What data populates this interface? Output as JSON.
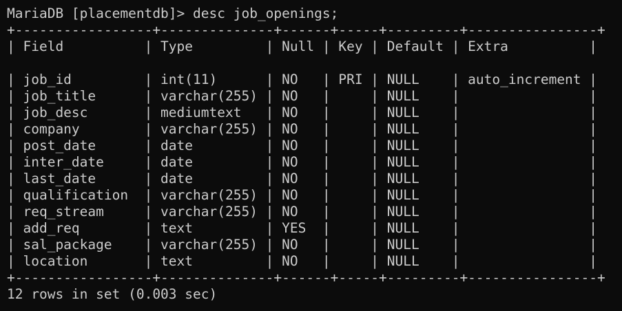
{
  "terminal": {
    "prompt": "MariaDB [placementdb]>",
    "command": " desc job_openings;",
    "border": "+-----------------+--------------+------+-----+---------+----------------+",
    "blank": "",
    "header": "| Field          | Type         | Null | Key | Default | Extra          |",
    "rows": [
      "| job_id         | int(11)      | NO   | PRI | NULL    | auto_increment |",
      "| job_title      | varchar(255) | NO   |     | NULL    |                |",
      "| job_desc       | mediumtext   | NO   |     | NULL    |                |",
      "| company        | varchar(255) | NO   |     | NULL    |                |",
      "| post_date      | date         | NO   |     | NULL    |                |",
      "| inter_date     | date         | NO   |     | NULL    |                |",
      "| last_date      | date         | NO   |     | NULL    |                |",
      "| qualification  | varchar(255) | NO   |     | NULL    |                |",
      "| req_stream     | varchar(255) | NO   |     | NULL    |                |",
      "| add_req        | text         | YES  |     | NULL    |                |",
      "| sal_package    | varchar(255) | NO   |     | NULL    |                |",
      "| location       | text         | NO   |     | NULL    |                |"
    ],
    "footer_border": "+-----------------+--------------+------+-----+---------+----------------+",
    "summary": "12 rows in set (0.003 sec)"
  },
  "colors": {
    "background": "#0c0c0c",
    "text": "#cccccc"
  }
}
